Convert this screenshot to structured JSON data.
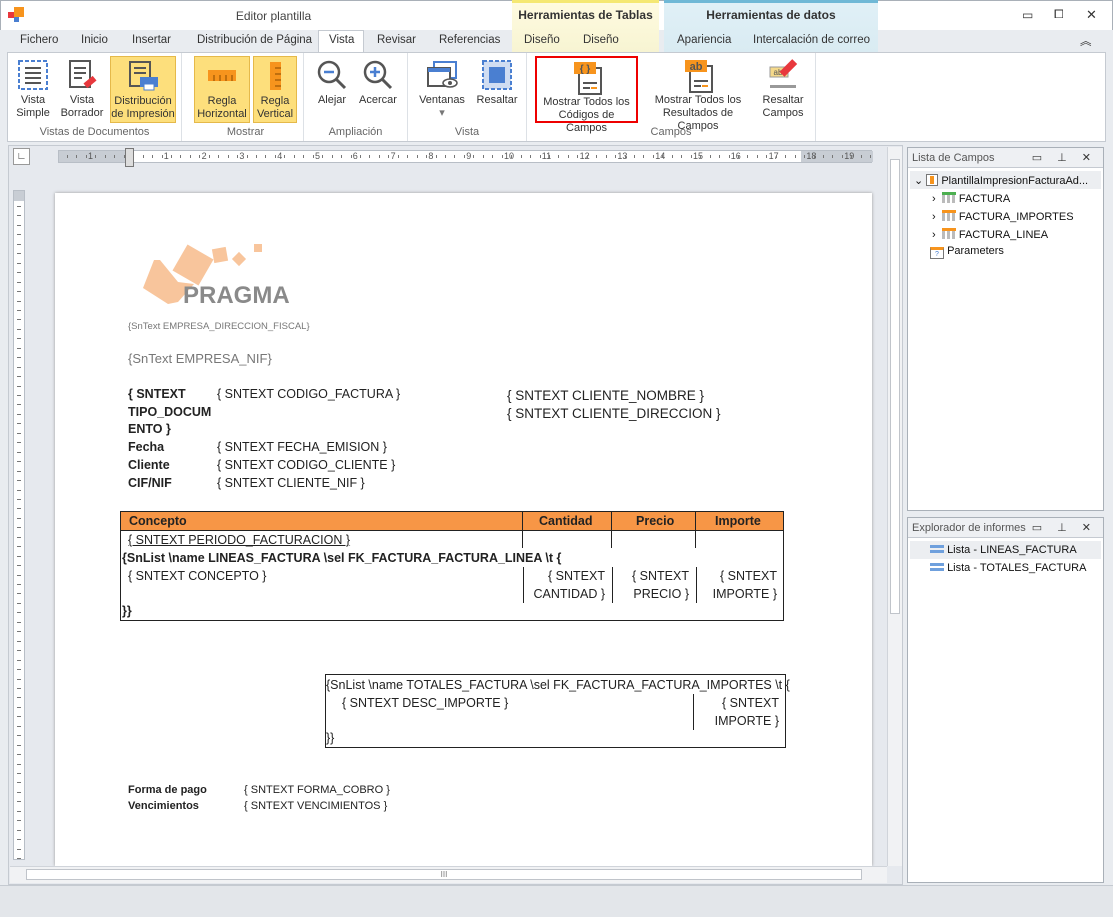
{
  "window": {
    "title": "Editor plantilla",
    "controls": {
      "minimize": "▭",
      "restore": "⧠",
      "close": "✕"
    },
    "collapse": "︽"
  },
  "context_tabs": {
    "tablas": {
      "label": "Herramientas de Tablas",
      "color": "#f5e873"
    },
    "datos": {
      "label": "Herramientas de datos",
      "color": "#6fb8d6"
    }
  },
  "tabs": [
    "Fichero",
    "Inicio",
    "Insertar",
    "Distribución de Página",
    "Vista",
    "Revisar",
    "Referencias",
    "Diseño",
    "Diseño",
    "Apariencia",
    "Intercalación de correo"
  ],
  "active_tab": "Vista",
  "ribbon": {
    "groups": [
      {
        "label": "Vistas de Documentos",
        "buttons": [
          {
            "l1": "Vista",
            "l2": "Simple"
          },
          {
            "l1": "Vista",
            "l2": "Borrador"
          },
          {
            "l1": "Distribución",
            "l2": "de Impresión",
            "active": true
          }
        ]
      },
      {
        "label": "Mostrar",
        "buttons": [
          {
            "l1": "Regla",
            "l2": "Horizontal",
            "active": true
          },
          {
            "l1": "Regla",
            "l2": "Vertical",
            "active": true
          }
        ]
      },
      {
        "label": "Ampliación",
        "buttons": [
          {
            "l1": "Alejar"
          },
          {
            "l1": "Acercar"
          }
        ]
      },
      {
        "label": "Vista",
        "buttons": [
          {
            "l1": "Ventanas",
            "l2": "▾"
          },
          {
            "l1": "Resaltar"
          }
        ]
      },
      {
        "label": "Campos",
        "buttons": [
          {
            "l1": "Mostrar Todos los",
            "l2": "Códigos de Campos",
            "highlighted": true,
            "badge": "{ }"
          },
          {
            "l1": "Mostrar Todos los",
            "l2": "Resultados de Campos",
            "badge": "ab"
          },
          {
            "l1": "Resaltar",
            "l2": "Campos",
            "badge": "ab"
          }
        ]
      }
    ]
  },
  "ruler": {
    "labels": [
      "1",
      "1",
      "2",
      "3",
      "4",
      "5",
      "6",
      "7",
      "8",
      "9",
      "10",
      "11",
      "12",
      "13",
      "14",
      "15",
      "16",
      "17",
      "18",
      "19"
    ]
  },
  "document": {
    "logo_text": "PRAGMA",
    "direccion": "{SnText EMPRESA_DIRECCION_FISCAL}",
    "nif": "{SnText EMPRESA_NIF}",
    "fields": [
      {
        "label": "{ SNTEXT",
        "value": "{ SNTEXT CODIGO_FACTURA }"
      },
      {
        "label": "TIPO_DOCUM",
        "value": ""
      },
      {
        "label": "ENTO }",
        "value": ""
      },
      {
        "label": "Fecha",
        "value": "{ SNTEXT FECHA_EMISION }"
      },
      {
        "label": "Cliente",
        "value": "{ SNTEXT CODIGO_CLIENTE }"
      },
      {
        "label": "CIF/NIF",
        "value": "{ SNTEXT CLIENTE_NIF }"
      }
    ],
    "cliente_nombre": "{ SNTEXT CLIENTE_NOMBRE }",
    "cliente_direccion": "{ SNTEXT CLIENTE_DIRECCION }",
    "table": {
      "header_color": "#f79646",
      "headers": [
        "Concepto",
        "Cantidad",
        "Precio",
        "Importe"
      ],
      "periodo": "{ SNTEXT PERIODO_FACTURACION }",
      "list_open": "{SnList \\name LINEAS_FACTURA \\sel FK_FACTURA_FACTURA_LINEA \\t {",
      "concepto": "{ SNTEXT CONCEPTO }",
      "cantidad": [
        "{ SNTEXT",
        "CANTIDAD }"
      ],
      "precio": [
        "{ SNTEXT",
        "PRECIO }"
      ],
      "importe": [
        "{ SNTEXT",
        "IMPORTE }"
      ],
      "list_close": "}}"
    },
    "totales": {
      "list_open": "{SnList \\name TOTALES_FACTURA \\sel FK_FACTURA_FACTURA_IMPORTES \\t {",
      "desc": "{ SNTEXT DESC_IMPORTE }",
      "importe": [
        "{ SNTEXT",
        "IMPORTE }"
      ],
      "list_close": "}}"
    },
    "footer": [
      {
        "label": "Forma de pago",
        "value": "{ SNTEXT FORMA_COBRO }"
      },
      {
        "label": "Vencimientos",
        "value": "{ SNTEXT VENCIMIENTOS }"
      }
    ]
  },
  "field_list": {
    "title": "Lista de Campos",
    "root": "PlantillaImpresionFacturaAd...",
    "children": [
      "FACTURA",
      "FACTURA_IMPORTES",
      "FACTURA_LINEA"
    ],
    "parameters": "Parameters"
  },
  "report_explorer": {
    "title": "Explorador de informes",
    "items": [
      "Lista - LINEAS_FACTURA",
      "Lista - TOTALES_FACTURA"
    ]
  },
  "panel_buttons": "▭ ⊥ ✕",
  "hscroll_grip": "III"
}
